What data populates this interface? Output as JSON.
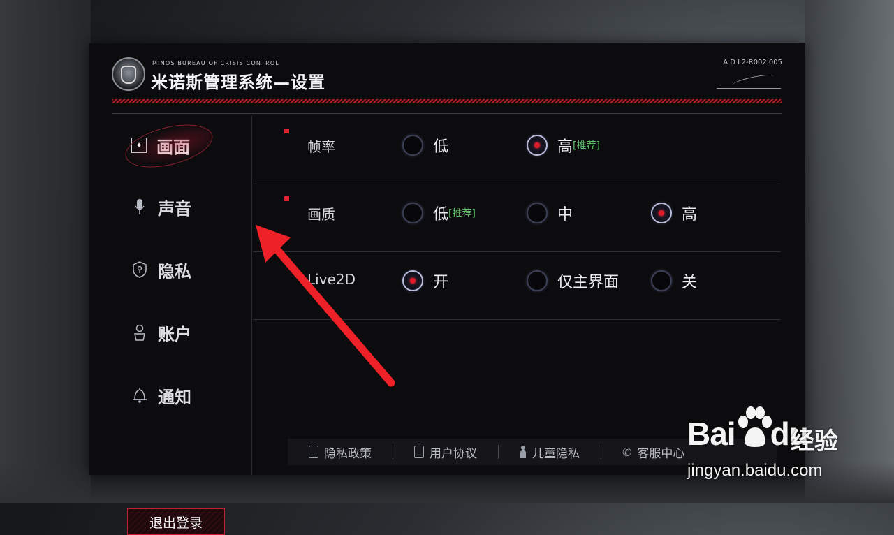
{
  "header": {
    "org_name": "MINOS BUREAU OF  CRISIS CONTROL",
    "title": "米诺斯管理系统—设置",
    "ref_code": "A D  L2-R002.005"
  },
  "sidebar": {
    "items": [
      {
        "label": "画面",
        "icon": "screen-icon",
        "active": true
      },
      {
        "label": "声音",
        "icon": "microphone-icon",
        "active": false
      },
      {
        "label": "隐私",
        "icon": "shield-lock-icon",
        "active": false
      },
      {
        "label": "账户",
        "icon": "person-icon",
        "active": false
      },
      {
        "label": "通知",
        "icon": "bell-icon",
        "active": false
      }
    ],
    "logout_label": "退出登录"
  },
  "settings": {
    "rows": [
      {
        "label": "帧率",
        "options": [
          {
            "label": "低",
            "selected": false,
            "recommended": ""
          },
          {
            "label": "高",
            "selected": true,
            "recommended": "[推荐]"
          }
        ]
      },
      {
        "label": "画质",
        "options": [
          {
            "label": "低",
            "selected": false,
            "recommended": "[推荐]"
          },
          {
            "label": "中",
            "selected": false,
            "recommended": ""
          },
          {
            "label": "高",
            "selected": true,
            "recommended": ""
          }
        ]
      },
      {
        "label": "Live2D",
        "options": [
          {
            "label": "开",
            "selected": true,
            "recommended": ""
          },
          {
            "label": "仅主界面",
            "selected": false,
            "recommended": ""
          },
          {
            "label": "关",
            "selected": false,
            "recommended": ""
          }
        ]
      }
    ]
  },
  "footer": {
    "links": [
      {
        "label": "隐私政策",
        "icon": "document-icon"
      },
      {
        "label": "用户协议",
        "icon": "clipboard-check-icon"
      },
      {
        "label": "儿童隐私",
        "icon": "child-icon"
      },
      {
        "label": "客服中心",
        "icon": "phone-icon"
      }
    ]
  },
  "watermark": {
    "brand": "Bai",
    "brand_du": "du",
    "product": "经验",
    "url": "jingyan.baidu.com"
  },
  "colors": {
    "accent_red": "#e0212f",
    "recommend_green": "#5fbf6a",
    "panel_bg": "#0c0c0e"
  }
}
